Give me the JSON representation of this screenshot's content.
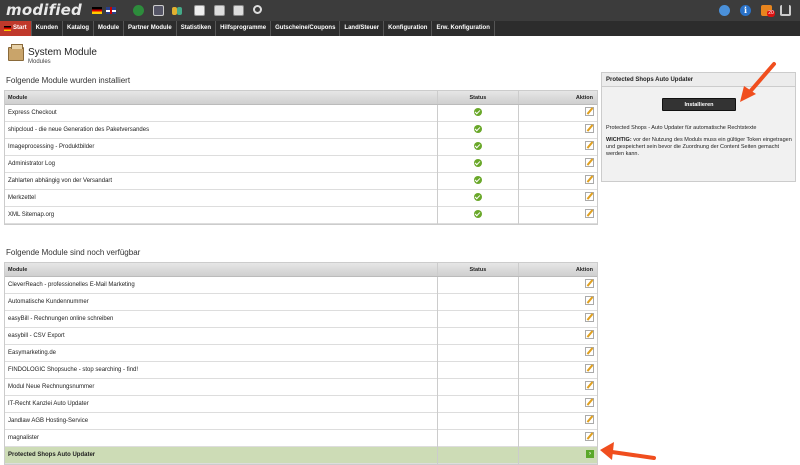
{
  "app": {
    "logo": "modified"
  },
  "topbar": {
    "badge": "20"
  },
  "nav": {
    "items": [
      "Start",
      "Kunden",
      "Katalog",
      "Module",
      "Partner Module",
      "Statistiken",
      "Hilfsprogramme",
      "Gutscheine/Coupons",
      "Land/Steuer",
      "Konfiguration",
      "Erw. Konfiguration"
    ],
    "active": "Start"
  },
  "page": {
    "title": "System Module",
    "subtitle": "Modules"
  },
  "installed": {
    "title": "Folgende Module wurden installiert",
    "headers": [
      "Module",
      "Status",
      "Aktion"
    ],
    "rows": [
      "Express Checkout",
      "shipcloud - die neue Generation des Paketversandes",
      "Imageprocessing - Produktbilder",
      "Administrator Log",
      "Zahlarten abhängig von der Versandart",
      "Merkzettel",
      "XML Sitemap.org"
    ]
  },
  "available": {
    "title": "Folgende Module sind noch verfügbar",
    "headers": [
      "Module",
      "Status",
      "Aktion"
    ],
    "rows": [
      "CleverReach - professionelles E-Mail Marketing",
      "Automatische Kundennummer",
      "easyBill - Rechnungen online schreiben",
      "easybill - CSV Export",
      "Easymarketing.de",
      "FINDOLOGIC Shopsuche - stop searching - find!",
      "Modul Neue Rechnungsnummer",
      "IT-Recht Kanzlei Auto Updater",
      "Jandlaw AGB Hosting-Service",
      "magnalister",
      "Protected Shops Auto Updater"
    ],
    "highlighted": "Protected Shops Auto Updater"
  },
  "panel": {
    "title": "Protected Shops Auto Updater",
    "button": "Installieren",
    "description": "Protected Shops - Auto Updater für automatische Rechtstexte",
    "warning_label": "WICHTIG:",
    "warning_text": " vor der Nutzung des Moduls muss ein gültiger Token eingetragen und gespeichert sein bevor die Zuordnung der Content Seiten gemacht werden kann."
  },
  "colors": {
    "accent": "#c0392b",
    "highlight_row": "#cddcb6",
    "arrow": "#f04e1e"
  }
}
